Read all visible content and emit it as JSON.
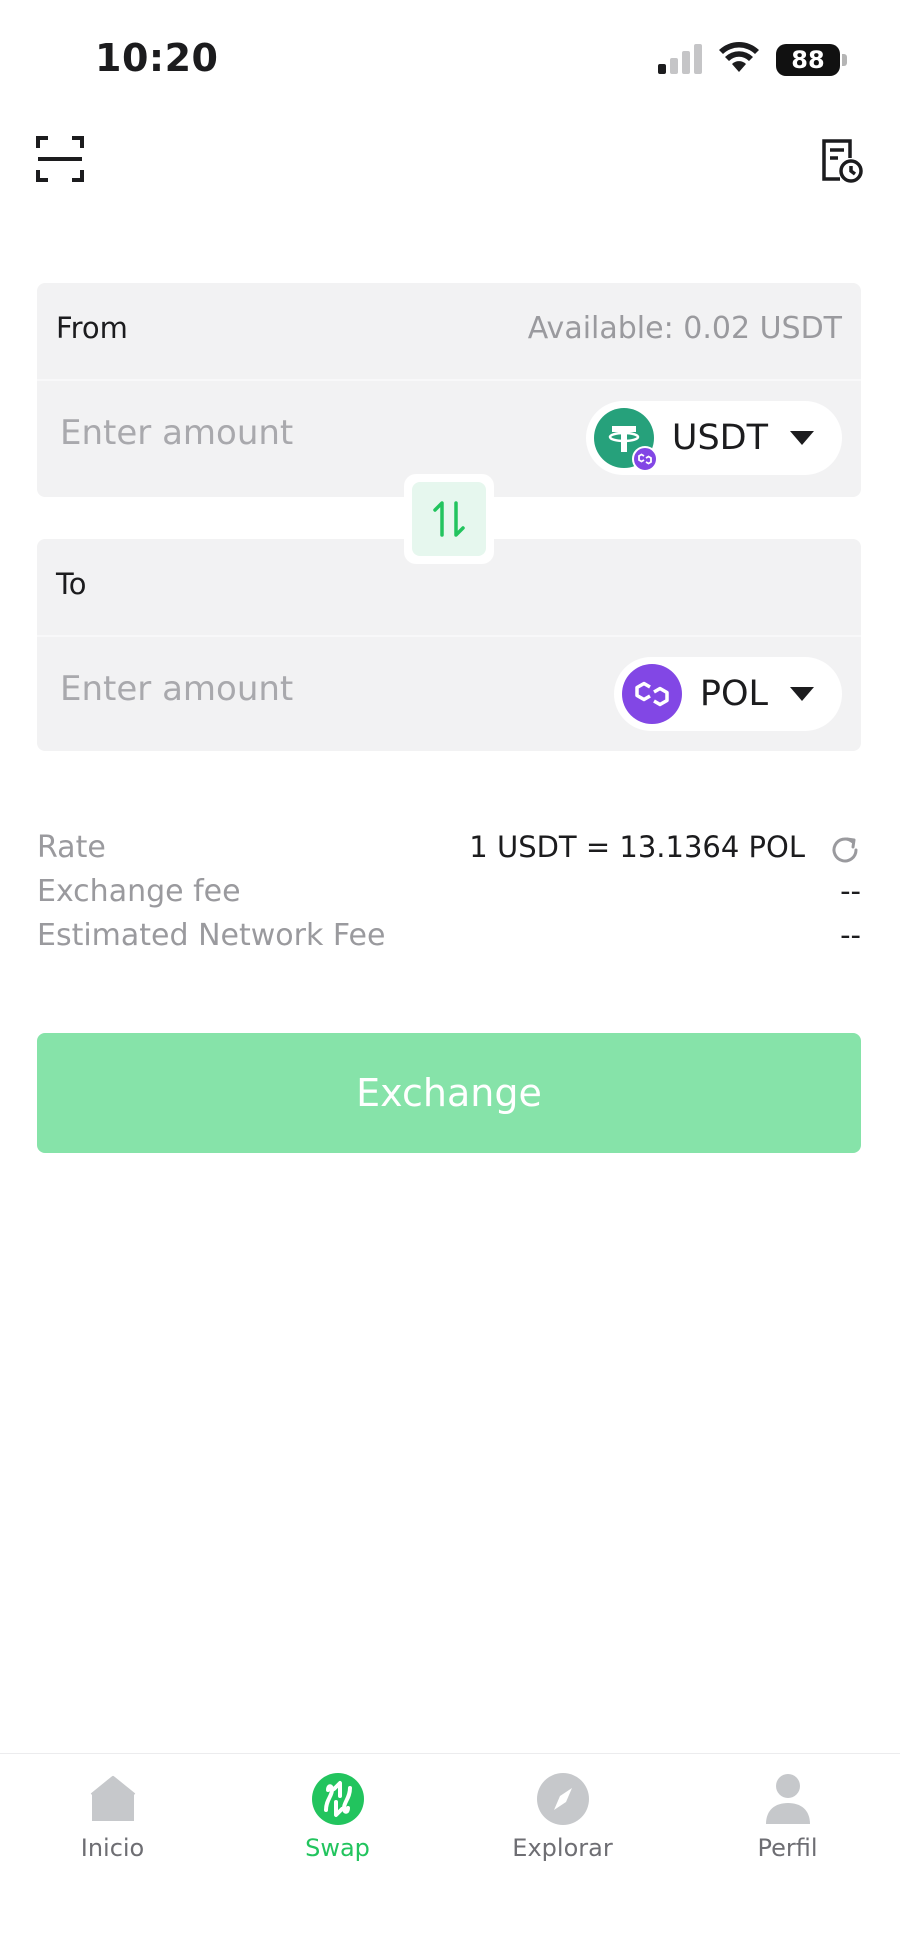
{
  "status_bar": {
    "time": "10:20",
    "battery": "88"
  },
  "from": {
    "label": "From",
    "available": "Available: 0.02 USDT",
    "amount_placeholder": "Enter amount",
    "token": "USDT"
  },
  "to": {
    "label": "To",
    "amount_placeholder": "Enter amount",
    "token": "POL"
  },
  "info": {
    "rate_label": "Rate",
    "rate_value": "1 USDT = 13.1364 POL",
    "exchange_fee_label": "Exchange fee",
    "exchange_fee_value": "--",
    "network_fee_label": "Estimated Network Fee",
    "network_fee_value": "--"
  },
  "exchange_button": "Exchange",
  "tabs": [
    {
      "label": "Inicio",
      "icon": "home-icon",
      "active": false
    },
    {
      "label": "Swap",
      "icon": "swap-icon",
      "active": true
    },
    {
      "label": "Explorar",
      "icon": "compass-icon",
      "active": false
    },
    {
      "label": "Perfil",
      "icon": "profile-icon",
      "active": false
    }
  ],
  "colors": {
    "accent": "#22c45e",
    "button_disabled": "#86e3a9",
    "card_bg": "#f2f2f3",
    "usdt": "#26a17b",
    "pol": "#8247e5"
  }
}
